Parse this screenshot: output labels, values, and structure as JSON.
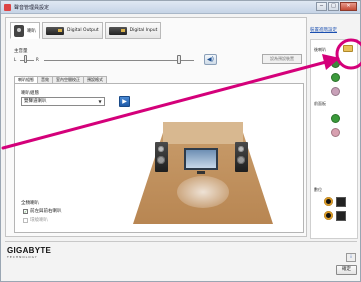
{
  "window": {
    "title": "聲音管理員設定",
    "minimize": "─",
    "maximize": "□",
    "close": "✕"
  },
  "device_tabs": [
    {
      "label": "喇叭"
    },
    {
      "label": "Digital Output"
    },
    {
      "label": "Digital Input"
    }
  ],
  "volume": {
    "label": "主音量",
    "left": "L",
    "right": "R",
    "set_default": "設為預設裝置"
  },
  "sub_tabs": [
    "喇叭組態",
    "音效",
    "室內空間校正",
    "預設格式"
  ],
  "speaker_config": {
    "label": "喇叭組態",
    "selected": "雙聲道喇叭"
  },
  "full_range": {
    "label": "全頻喇叭",
    "options": [
      {
        "label": "前左與前右喇叭",
        "checked": true
      },
      {
        "label": "環繞喇叭",
        "checked": false
      }
    ]
  },
  "right_panel": {
    "advanced_link": "裝置進階設定",
    "rear_label": "後喇叭",
    "front_label": "前面板",
    "digital_label": "數位",
    "jack_colors": [
      "#3c8a3c",
      "#3c9a3c",
      "#c8a0b8",
      "#3a9a3a",
      "#d8a0b0"
    ]
  },
  "brand": {
    "name": "GIGABYTE",
    "tagline": "TECHNOLOGY"
  },
  "buttons": {
    "info": "i",
    "ok": "確定"
  },
  "annotation": {
    "color": "#d4007a"
  }
}
